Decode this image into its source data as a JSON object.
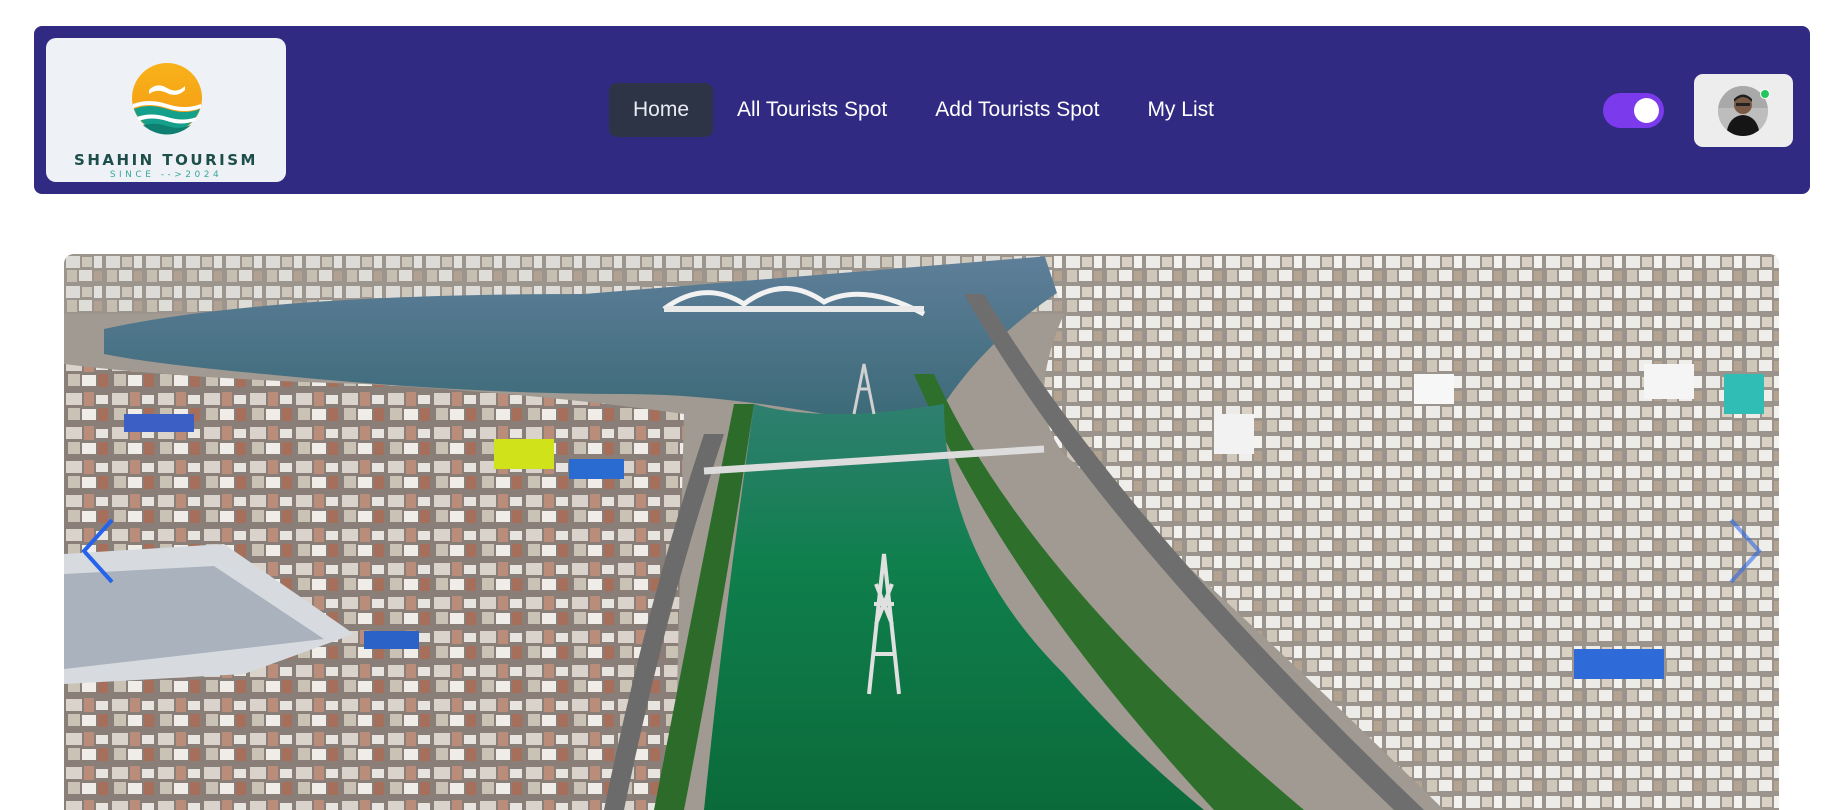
{
  "brand": {
    "name": "SHAHIN TOURISM",
    "tagline": "SINCE -->2024",
    "logo_icon": "sun-wave-logo"
  },
  "nav": {
    "items": [
      {
        "label": "Home",
        "active": true
      },
      {
        "label": "All Tourists Spot",
        "active": false
      },
      {
        "label": "Add Tourists Spot",
        "active": false
      },
      {
        "label": "My List",
        "active": false
      }
    ]
  },
  "theme_toggle": {
    "on": true,
    "color": "#7c3aed"
  },
  "user": {
    "avatar_icon": "user-avatar",
    "online": true,
    "status_color": "#22c55e"
  },
  "hero": {
    "image": "aerial city lake bridge photo",
    "prev_icon": "chevron-left-icon",
    "next_icon": "chevron-right-icon"
  },
  "colors": {
    "navbar_bg": "#312a83",
    "active_link_bg": "#2c3446",
    "page_bg": "#ffffff"
  }
}
